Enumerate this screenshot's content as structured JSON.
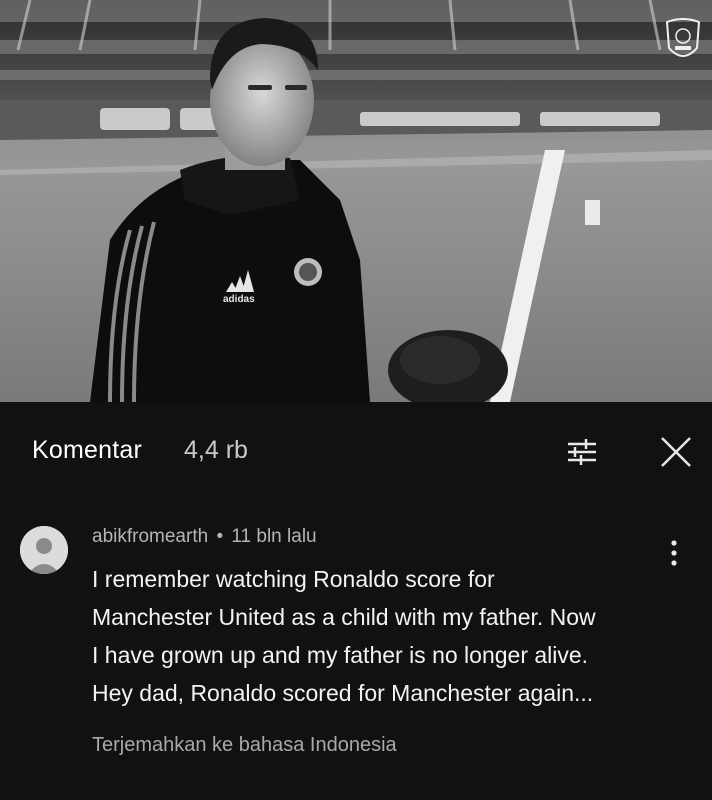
{
  "video": {
    "thumbnail_description_icon": "stadium-interview-image",
    "jacket_brand": "adidas",
    "club_badge_icon": "club-crest-icon"
  },
  "comments_panel": {
    "title": "Komentar",
    "count": "4,4 rb",
    "filter_icon": "sliders-icon",
    "close_icon": "close-icon"
  },
  "comment": {
    "author": "abikfromearth",
    "separator": "•",
    "time": "11 bln lalu",
    "lines": [
      "I remember watching Ronaldo score for",
      "Manchester United as a child with my father. Now",
      "I have grown up and my father is no longer alive.",
      "Hey dad, Ronaldo scored for Manchester again..."
    ],
    "translate_link": "Terjemahkan ke bahasa Indonesia",
    "menu_icon": "more-vert-icon"
  },
  "colors": {
    "panel_bg": "#111111",
    "text_primary": "#f3f3f3",
    "text_secondary": "#b5b5b5"
  }
}
